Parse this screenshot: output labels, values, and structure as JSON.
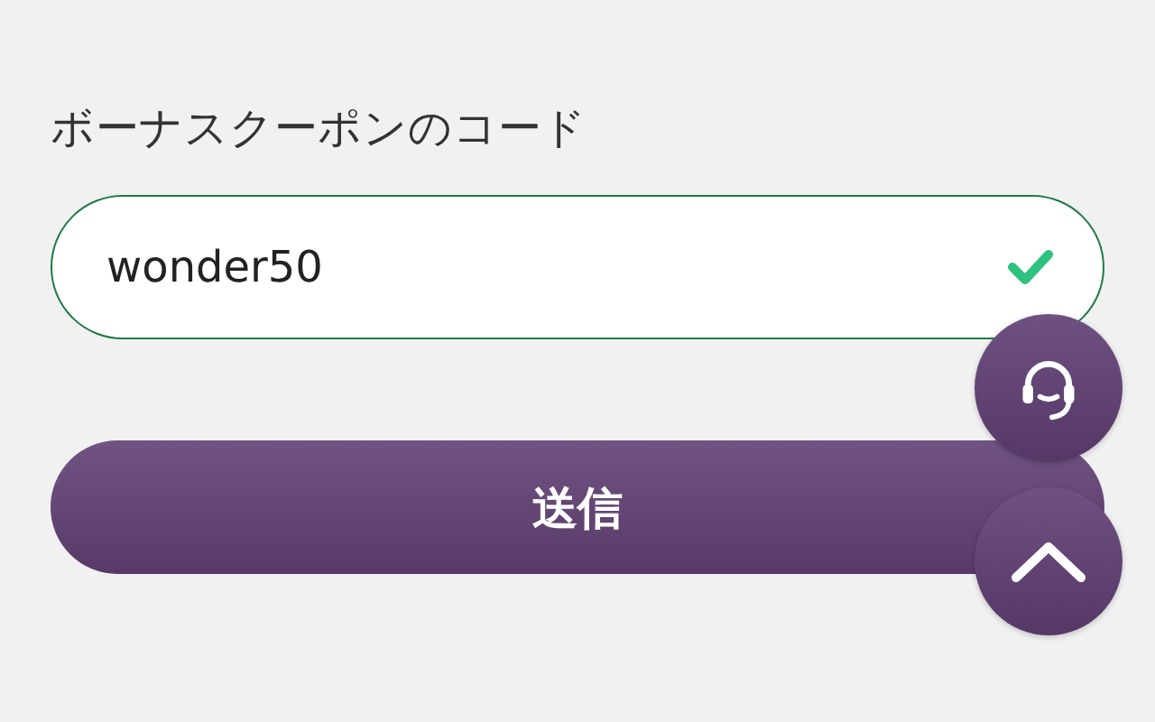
{
  "coupon": {
    "label": "ボーナスクーポンのコード",
    "value": "wonder50",
    "valid": true
  },
  "submit_button": {
    "label": "送信"
  }
}
